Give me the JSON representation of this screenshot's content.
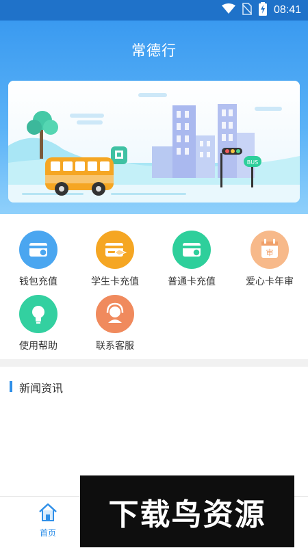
{
  "status_bar": {
    "time": "08:41",
    "icons": [
      "wifi-icon",
      "no-sim-icon",
      "battery-charging-icon"
    ]
  },
  "header": {
    "title": "常德行"
  },
  "banner": {
    "bus_sign": "BUS"
  },
  "menu": {
    "items": [
      {
        "label": "钱包充值",
        "icon": "wallet-card-icon",
        "color": "#4aa6f0"
      },
      {
        "label": "学生卡充值",
        "icon": "student-card-icon",
        "color": "#f5a623"
      },
      {
        "label": "普通卡充值",
        "icon": "normal-card-icon",
        "color": "#2ecf9b"
      },
      {
        "label": "爱心卡年审",
        "icon": "calendar-audit-icon",
        "color": "#f7b98a",
        "badge": "审"
      },
      {
        "label": "使用帮助",
        "icon": "lightbulb-icon",
        "color": "#33d0a0"
      },
      {
        "label": "联系客服",
        "icon": "customer-service-icon",
        "color": "#f08a5d"
      }
    ]
  },
  "news": {
    "title": "新闻资讯"
  },
  "tabbar": {
    "home_label": "首页"
  },
  "watermark": {
    "text": "下载鸟资源"
  }
}
